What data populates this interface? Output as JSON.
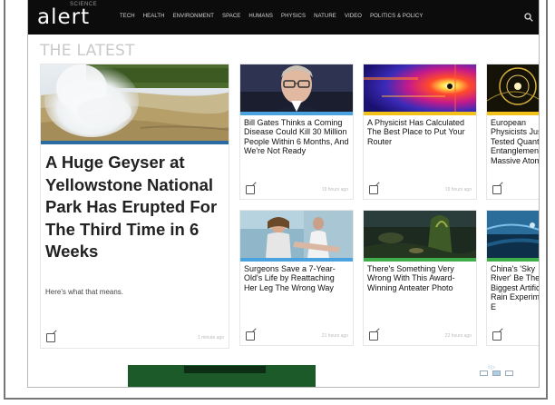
{
  "header": {
    "logo_text": "alert",
    "logo_tagline": "SCIENCE",
    "nav": [
      "TECH",
      "HEALTH",
      "ENVIRONMENT",
      "SPACE",
      "HUMANS",
      "PHYSICS",
      "NATURE",
      "VIDEO",
      "POLITICS & POLICY"
    ]
  },
  "section_title": "THE LATEST",
  "hero": {
    "title": "A Huge Geyser at Yellowstone National Park Has Erupted For The Third Time in 6 Weeks",
    "subtitle": "Here's what that means.",
    "time": "1 minute ago",
    "stripe_color": "#2b6aa3"
  },
  "cards": [
    {
      "title": "Bill Gates Thinks a Coming Disease Could Kill 30 Million People Within 6 Months, And We're Not Ready",
      "time": "19 hours ago",
      "stripe_color": "#4aa3df"
    },
    {
      "title": "A Physicist Has Calculated The Best Place to Put Your Router",
      "time": "19 hours ago",
      "stripe_color": "#f2c21a"
    },
    {
      "title": "European Physicists Just Tested Quantum Entanglement in Massive Atom",
      "time": "",
      "stripe_color": "#f2c21a"
    },
    {
      "title": "Surgeons Save a 7-Year-Old's Life by Reattaching Her Leg The Wrong Way",
      "time": "21 hours ago",
      "stripe_color": "#4aa3df"
    },
    {
      "title": "There's Something Very Wrong With This Award-Winning Anteater Photo",
      "time": "22 hours ago",
      "stripe_color": "#3fae4a"
    },
    {
      "title": "China's 'Sky River' Be The Biggest Artificial Rain Experiment E",
      "time": "",
      "stripe_color": "#3fae4a"
    }
  ],
  "ad": {
    "label": "i ▷"
  }
}
